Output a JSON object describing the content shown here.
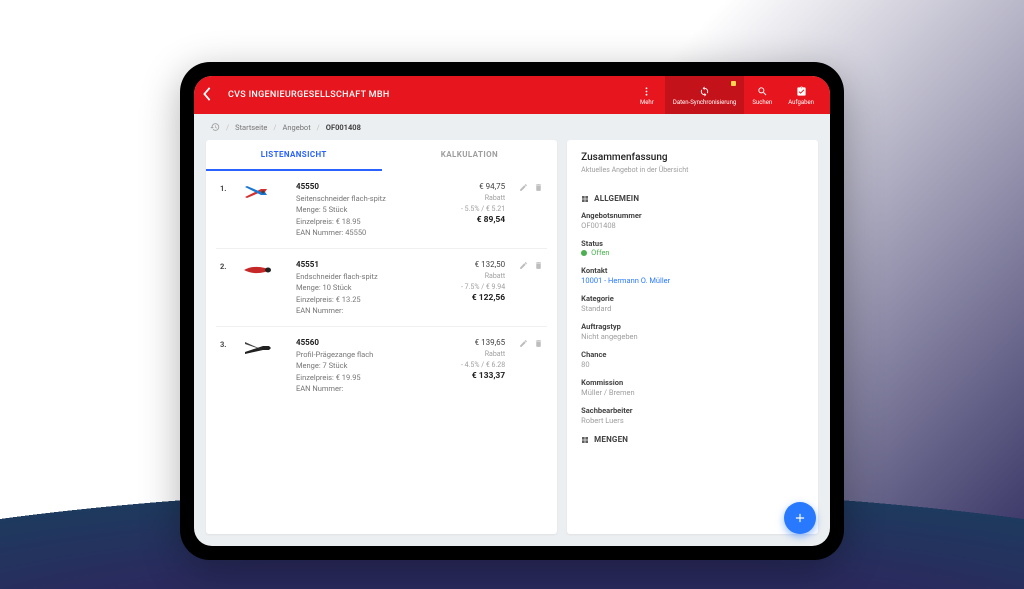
{
  "header": {
    "title": "CVS INGENIEURGESELLSCHAFT MBH",
    "actions": {
      "more": "Mehr",
      "sync": "Daten-Synchronisierung",
      "search": "Suchen",
      "tasks": "Aufgaben"
    }
  },
  "breadcrumb": {
    "home": "Startseite",
    "offer": "Angebot",
    "current": "OF001408"
  },
  "tabs": {
    "list": "LISTENANSICHT",
    "calc": "KALKULATION"
  },
  "items": [
    {
      "idx": "1.",
      "sku": "45550",
      "name": "Seitenschneider flach-spitz",
      "qty": "Menge: 5 Stück",
      "unit": "Einzelpreis: € 18.95",
      "ean": "EAN Nummer: 45550",
      "price": "€ 94,75",
      "rabatt_label": "Rabatt",
      "rabatt_val": "- 5.5% / € 5.21",
      "total": "€ 89,54"
    },
    {
      "idx": "2.",
      "sku": "45551",
      "name": "Endschneider flach-spitz",
      "qty": "Menge: 10 Stück",
      "unit": "Einzelpreis: € 13.25",
      "ean": "EAN Nummer:",
      "price": "€ 132,50",
      "rabatt_label": "Rabatt",
      "rabatt_val": "- 7.5% / € 9.94",
      "total": "€ 122,56"
    },
    {
      "idx": "3.",
      "sku": "45560",
      "name": "Profil-Prägezange flach",
      "qty": "Menge: 7 Stück",
      "unit": "Einzelpreis: € 19.95",
      "ean": "EAN Nummer:",
      "price": "€ 139,65",
      "rabatt_label": "Rabatt",
      "rabatt_val": "- 4.5% / € 6.28",
      "total": "€ 133,37"
    }
  ],
  "summary": {
    "title": "Zusammenfassung",
    "subtitle": "Aktuelles Angebot in der Übersicht",
    "section_general": "ALLGEMEIN",
    "section_qty": "MENGEN",
    "fields": {
      "offer_no_label": "Angebotsnummer",
      "offer_no": "OF001408",
      "status_label": "Status",
      "status": "Offen",
      "contact_label": "Kontakt",
      "contact": "10001 - Hermann O. Müller",
      "category_label": "Kategorie",
      "category": "Standard",
      "ordertype_label": "Auftragstyp",
      "ordertype": "Nicht angegeben",
      "chance_label": "Chance",
      "chance": "80",
      "commission_label": "Kommission",
      "commission": "Müller / Bremen",
      "clerk_label": "Sachbearbeiter",
      "clerk": "Robert Luers"
    }
  }
}
